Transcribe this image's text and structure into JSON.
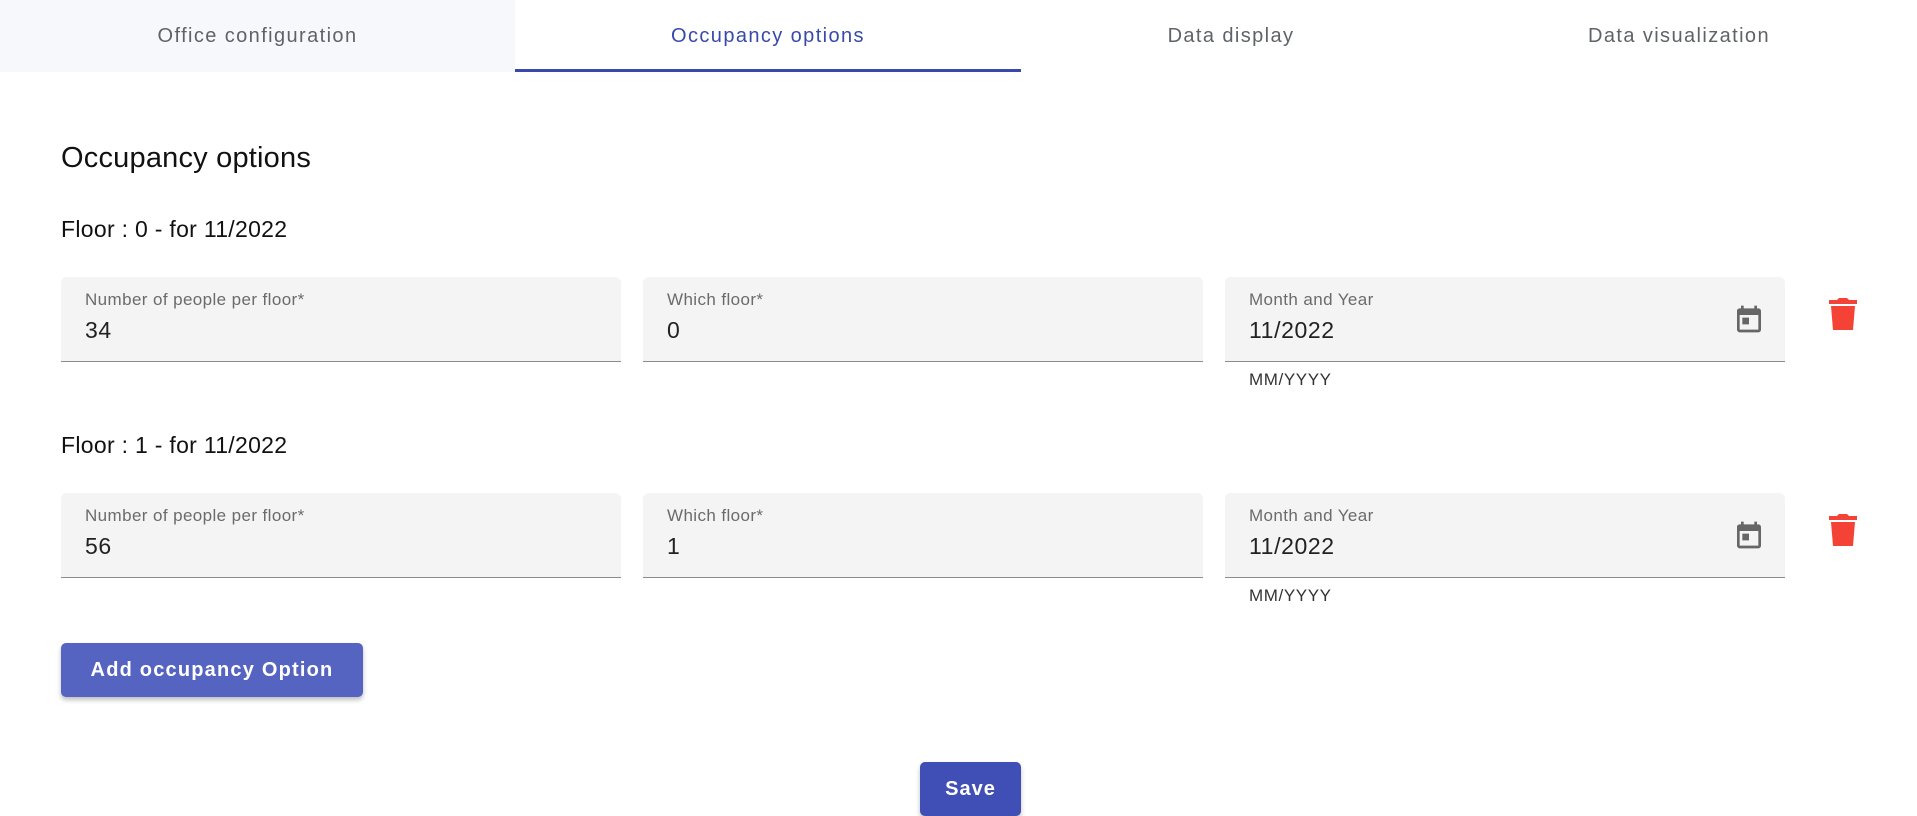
{
  "tabs": [
    {
      "label": "Office configuration"
    },
    {
      "label": "Occupancy options"
    },
    {
      "label": "Data display"
    },
    {
      "label": "Data visualization"
    }
  ],
  "active_tab": "Occupancy options",
  "page_title": "Occupancy options",
  "entries": [
    {
      "heading": "Floor : 0 - for 11/2022",
      "people_label": "Number of people per floor*",
      "people_value": "34",
      "floor_label": "Which floor*",
      "floor_value": "0",
      "date_label": "Month and Year",
      "date_value": "11/2022",
      "date_hint": "MM/YYYY"
    },
    {
      "heading": "Floor : 1 - for 11/2022",
      "people_label": "Number of people per floor*",
      "people_value": "56",
      "floor_label": "Which floor*",
      "floor_value": "1",
      "date_label": "Month and Year",
      "date_value": "11/2022",
      "date_hint": "MM/YYYY"
    }
  ],
  "add_button_label": "Add occupancy Option",
  "save_button_label": "Save",
  "icons": {
    "calendar": "calendar-icon",
    "delete": "trash-icon"
  },
  "colors": {
    "accent": "#3949ab",
    "button": "#5563c1",
    "delete": "#f44336"
  }
}
